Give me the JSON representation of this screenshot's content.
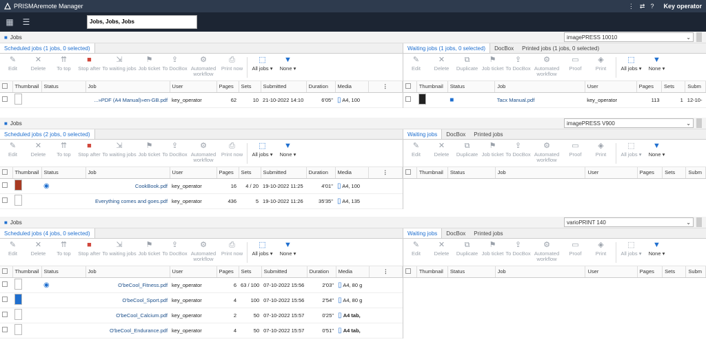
{
  "app": {
    "title": "PRISMAremote Manager",
    "user": "Key operator"
  },
  "search": {
    "value": "Jobs, Jobs, Jobs"
  },
  "toolbar_left": [
    "Edit",
    "Delete",
    "To top",
    "Stop after",
    "To waiting jobs",
    "Job ticket",
    "To DocBox",
    "Automated workflow",
    "Print now"
  ],
  "toolbar_right": [
    "Edit",
    "Delete",
    "Duplicate",
    "Job ticket",
    "To DocBox",
    "Automated workflow",
    "Proof",
    "Print"
  ],
  "filters": {
    "all_jobs": "All jobs",
    "none": "None"
  },
  "left_cols": [
    "Thumbnail",
    "Status",
    "Job",
    "User",
    "Pages",
    "Sets",
    "Submitted",
    "Duration",
    "Media"
  ],
  "right_cols": [
    "Thumbnail",
    "Status",
    "Job",
    "User",
    "Pages",
    "Sets",
    "Subm"
  ],
  "sections": [
    {
      "label": "Jobs",
      "printer": "imagePRESS 10010",
      "left_tab": "Scheduled jobs (1 jobs, 0 selected)",
      "right_tabs": [
        "Waiting jobs (1 jobs, 0 selected)",
        "DocBox",
        "Printed jobs (1 jobs, 0 selected)"
      ],
      "rows": [
        {
          "job": "...»PDF (A4 Manual)»en-GB.pdf",
          "user": "key_operator",
          "pages": "62",
          "sets": "10",
          "submitted": "21-10-2022 14:10",
          "duration": "6'05''",
          "media": "A4, 100"
        }
      ],
      "right_rows": [
        {
          "job": "Tacx Manual.pdf",
          "user": "key_operator",
          "pages": "113",
          "sets": "1",
          "subm": "12-10-"
        }
      ]
    },
    {
      "label": "Jobs",
      "printer": "imagePRESS V900",
      "left_tab": "Scheduled jobs (2 jobs, 0 selected)",
      "right_tabs": [
        "Waiting jobs",
        "DocBox",
        "Printed jobs"
      ],
      "rows": [
        {
          "job": "CookBook.pdf",
          "user": "key_operator",
          "pages": "16",
          "sets": "4 / 20",
          "submitted": "19-10-2022 11:25",
          "duration": "4'01''",
          "media": "A4, 100"
        },
        {
          "job": "Everything comes and goes.pdf",
          "user": "key_operator",
          "pages": "436",
          "sets": "5",
          "submitted": "19-10-2022 11:26",
          "duration": "35'35''",
          "media": "A4, 135"
        }
      ],
      "right_rows": []
    },
    {
      "label": "Jobs",
      "printer": "varioPRINT 140",
      "left_tab": "Scheduled jobs (4 jobs, 0 selected)",
      "right_tabs": [
        "Waiting jobs",
        "DocBox",
        "Printed jobs"
      ],
      "rows": [
        {
          "job": "O'beCool_Fitness.pdf",
          "user": "key_operator",
          "pages": "6",
          "sets": "63 / 100",
          "submitted": "07-10-2022 15:56",
          "duration": "2'03''",
          "media": "A4, 80 g"
        },
        {
          "job": "O'beCool_Sport.pdf",
          "user": "key_operator",
          "pages": "4",
          "sets": "100",
          "submitted": "07-10-2022 15:56",
          "duration": "2'54''",
          "media": "A4, 80 g"
        },
        {
          "job": "O'beCool_Calcium.pdf",
          "user": "key_operator",
          "pages": "2",
          "sets": "50",
          "submitted": "07-10-2022 15:57",
          "duration": "0'25''",
          "media": "A4 tab,"
        },
        {
          "job": "O'beCool_Endurance.pdf",
          "user": "key_operator",
          "pages": "4",
          "sets": "50",
          "submitted": "07-10-2022 15:57",
          "duration": "0'51''",
          "media": "A4 tab,"
        }
      ],
      "right_rows": []
    }
  ]
}
